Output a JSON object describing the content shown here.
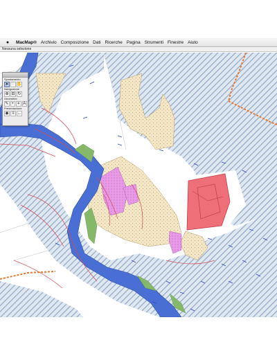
{
  "menubar": {
    "apple_icon": "",
    "app_name": "MacMap®",
    "items": [
      {
        "label": "Archivio"
      },
      {
        "label": "Composizione"
      },
      {
        "label": "Dati"
      },
      {
        "label": "Ricerche"
      },
      {
        "label": "Pagina"
      },
      {
        "label": "Strumenti"
      },
      {
        "label": "Finestre"
      },
      {
        "label": "Aiuto"
      }
    ]
  },
  "status": {
    "text": "Nessuna selezione"
  },
  "palette": {
    "sections": [
      {
        "label": "Spostamento"
      },
      {
        "label": "Navigazione"
      },
      {
        "label": "Geometrie"
      },
      {
        "label": "Presentazione"
      }
    ],
    "tools": [
      {
        "icon": "arrow-pointer-icon",
        "glyph": "➤"
      },
      {
        "icon": "lasso-icon",
        "glyph": "◌"
      },
      {
        "icon": "hand-icon",
        "glyph": "✋"
      },
      {
        "icon": "zoom-icon",
        "glyph": "⊕"
      },
      {
        "icon": "ruler-icon",
        "glyph": "⊟"
      },
      {
        "icon": "rotate-icon",
        "glyph": "↻"
      },
      {
        "icon": "pencil-icon",
        "glyph": "✎"
      },
      {
        "icon": "cross-icon",
        "glyph": "+"
      },
      {
        "icon": "node-icon",
        "glyph": "⋄"
      },
      {
        "icon": "text-icon",
        "glyph": "A"
      },
      {
        "icon": "eye-icon",
        "glyph": "◉"
      },
      {
        "icon": "layer-icon",
        "glyph": "≡"
      },
      {
        "icon": "measure-icon",
        "glyph": "↔"
      }
    ]
  },
  "colors": {
    "river": "#4a6fd4",
    "hatch": "#8fa8c8",
    "sand": "#f3e7c7",
    "magenta_zone": "#e79be6",
    "industrial": "#ee6f78",
    "vegetation": "#86b86a",
    "rail": "#e8772a",
    "roads": "#c0c0c0"
  }
}
